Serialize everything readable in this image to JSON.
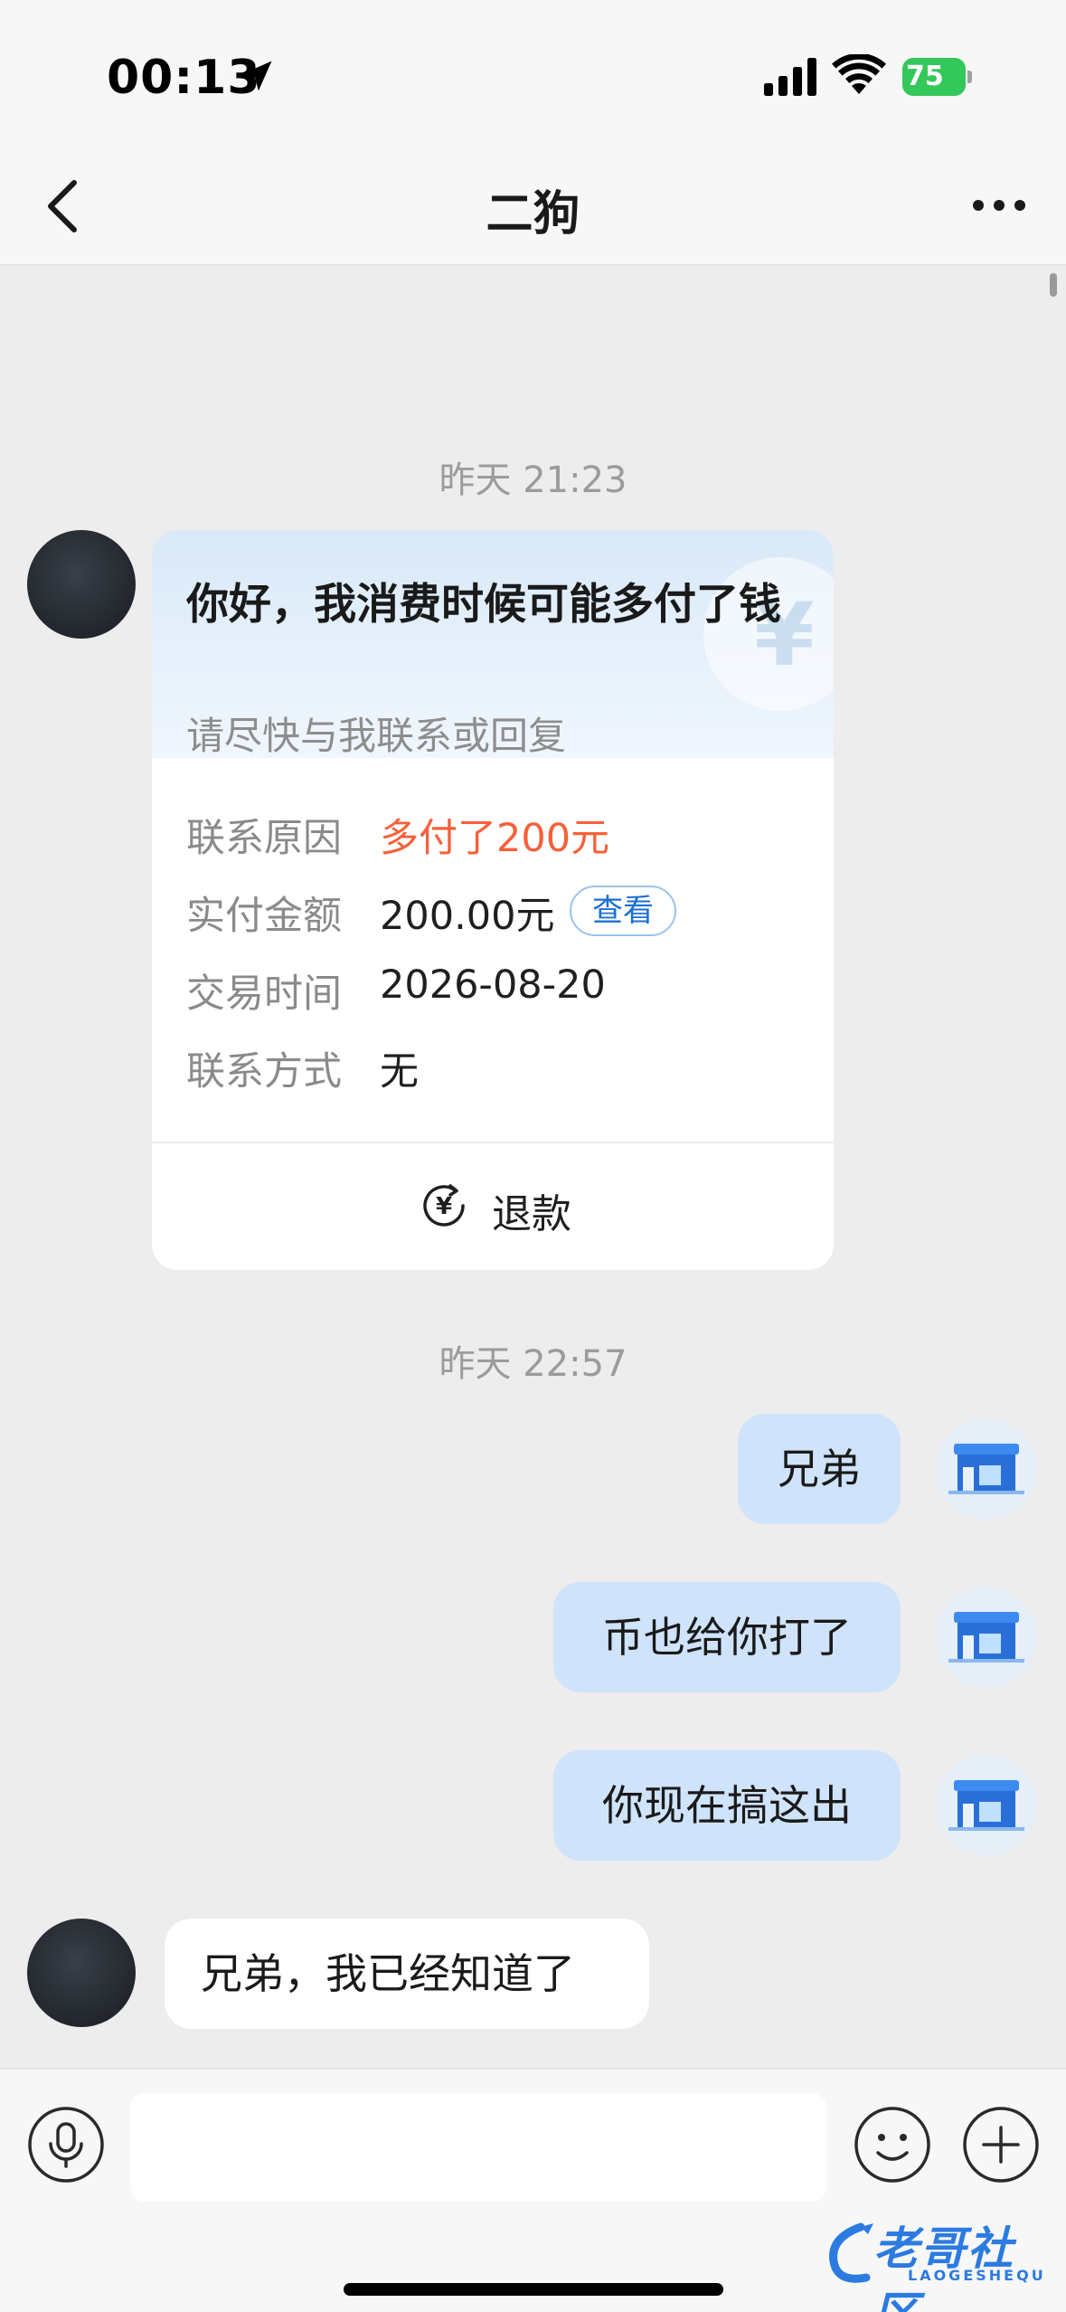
{
  "status_bar": {
    "time": "00:13",
    "battery": "75",
    "icons": [
      "location-arrow-icon",
      "cellular-signal-icon",
      "wifi-icon",
      "battery-charging-icon"
    ]
  },
  "nav": {
    "title": "二狗",
    "back_icon": "chevron-left-icon",
    "more_icon": "more-dots-icon"
  },
  "messages": {
    "timestamp_1": "昨天 21:23",
    "card": {
      "title": "你好，我消费时候可能多付了钱",
      "subtitle": "请尽快与我联系或回复",
      "rows": [
        {
          "label": "联系原因",
          "value": "多付了200元"
        },
        {
          "label": "实付金额",
          "value": "200.00元"
        },
        {
          "label": "交易时间",
          "value": "2026-08-20"
        },
        {
          "label": "联系方式",
          "value": "无"
        }
      ],
      "view_label": "查看",
      "refund_label": "退款",
      "refund_icon": "yen-refund-icon"
    },
    "timestamp_2": "昨天 22:57",
    "outgoing": [
      "兄弟",
      "币也给你打了",
      "你现在搞这出"
    ],
    "incoming_reply": "兄弟，我已经知道了"
  },
  "input_bar": {
    "input_value": "",
    "voice_icon": "microphone-icon",
    "emoji_icon": "emoji-smile-icon",
    "plus_icon": "plus-circle-icon"
  },
  "watermark": {
    "text": "老哥社区",
    "sub": "LAOGESHEQU"
  },
  "colors": {
    "accent_red": "#f5613a",
    "bubble_blue": "#cfe3fb",
    "link_blue": "#1a6fd3",
    "battery_green": "#34c759"
  }
}
